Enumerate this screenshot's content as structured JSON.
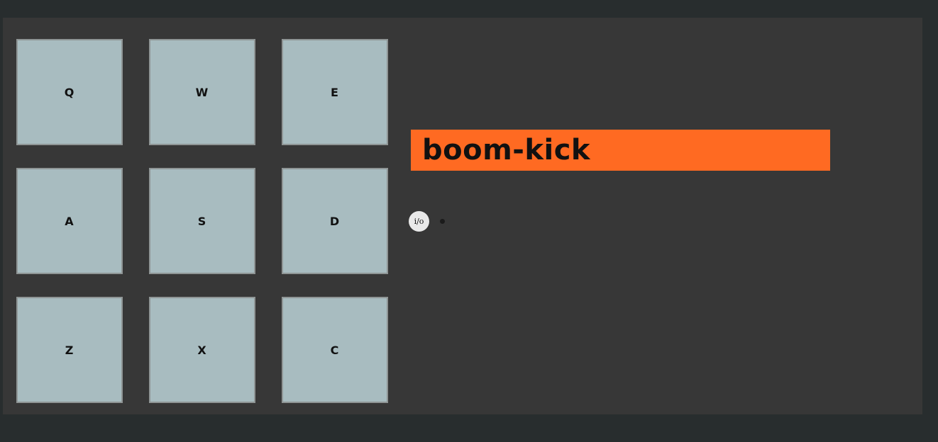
{
  "pads": [
    {
      "key": "Q"
    },
    {
      "key": "W"
    },
    {
      "key": "E"
    },
    {
      "key": "A"
    },
    {
      "key": "S"
    },
    {
      "key": "D"
    },
    {
      "key": "Z"
    },
    {
      "key": "X"
    },
    {
      "key": "C"
    }
  ],
  "display": {
    "text": "boom-kick"
  },
  "power": {
    "label": "i/o",
    "on": false
  },
  "colors": {
    "page_bg": "#282d2e",
    "panel_bg": "#373737",
    "pad_bg": "#a8bcc0",
    "display_bg": "#ff6a22"
  }
}
